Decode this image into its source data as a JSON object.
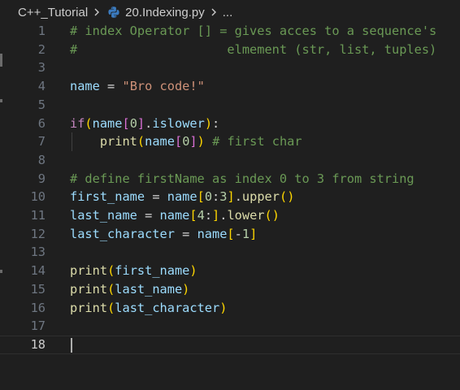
{
  "breadcrumb": {
    "folder": "C++_Tutorial",
    "file": "20.Indexing.py",
    "more": "..."
  },
  "theme": {
    "background": "#1f1f1f",
    "comment": "#6a9955",
    "variable": "#9cdcfe",
    "string": "#ce9178",
    "keyword": "#c586c0",
    "function": "#dcdcaa",
    "number": "#b5cea8",
    "bracket_level1": "#ffd700",
    "bracket_level2": "#da70d6",
    "bracket_level3": "#179fff"
  },
  "editor": {
    "current_line": 18,
    "lines": [
      {
        "num": "1",
        "tokens": [
          {
            "t": "# index Operator [] = gives acces to a sequence's",
            "c": "cm"
          }
        ]
      },
      {
        "num": "2",
        "tokens": [
          {
            "t": "#                    elmement (str, list, tuples)",
            "c": "cm"
          }
        ]
      },
      {
        "num": "3",
        "tokens": []
      },
      {
        "num": "4",
        "tokens": [
          {
            "t": "name",
            "c": "var"
          },
          {
            "t": " = ",
            "c": "op"
          },
          {
            "t": "\"Bro code!\"",
            "c": "str"
          }
        ]
      },
      {
        "num": "5",
        "tokens": []
      },
      {
        "num": "6",
        "tokens": [
          {
            "t": "if",
            "c": "kw"
          },
          {
            "t": "(",
            "c": "b1"
          },
          {
            "t": "name",
            "c": "var"
          },
          {
            "t": "[",
            "c": "b2"
          },
          {
            "t": "0",
            "c": "num"
          },
          {
            "t": "]",
            "c": "b2"
          },
          {
            "t": ".",
            "c": "op"
          },
          {
            "t": "islower",
            "c": "var"
          },
          {
            "t": ")",
            "c": "b1"
          },
          {
            "t": ":",
            "c": "op"
          }
        ]
      },
      {
        "num": "7",
        "tokens": [
          {
            "t": "    ",
            "c": "op"
          },
          {
            "t": "print",
            "c": "fn"
          },
          {
            "t": "(",
            "c": "b1"
          },
          {
            "t": "name",
            "c": "var"
          },
          {
            "t": "[",
            "c": "b2"
          },
          {
            "t": "0",
            "c": "num"
          },
          {
            "t": "]",
            "c": "b2"
          },
          {
            "t": ")",
            "c": "b1"
          },
          {
            "t": " ",
            "c": "op"
          },
          {
            "t": "# first char",
            "c": "cm"
          }
        ]
      },
      {
        "num": "8",
        "tokens": []
      },
      {
        "num": "9",
        "tokens": [
          {
            "t": "# define firstName as index 0 to 3 from string",
            "c": "cm"
          }
        ]
      },
      {
        "num": "10",
        "tokens": [
          {
            "t": "first_name",
            "c": "var"
          },
          {
            "t": " = ",
            "c": "op"
          },
          {
            "t": "name",
            "c": "var"
          },
          {
            "t": "[",
            "c": "b1"
          },
          {
            "t": "0",
            "c": "num"
          },
          {
            "t": ":",
            "c": "op"
          },
          {
            "t": "3",
            "c": "num"
          },
          {
            "t": "]",
            "c": "b1"
          },
          {
            "t": ".",
            "c": "op"
          },
          {
            "t": "upper",
            "c": "fn"
          },
          {
            "t": "(",
            "c": "b1"
          },
          {
            "t": ")",
            "c": "b1"
          }
        ]
      },
      {
        "num": "11",
        "tokens": [
          {
            "t": "last_name",
            "c": "var"
          },
          {
            "t": " = ",
            "c": "op"
          },
          {
            "t": "name",
            "c": "var"
          },
          {
            "t": "[",
            "c": "b1"
          },
          {
            "t": "4",
            "c": "num"
          },
          {
            "t": ":",
            "c": "op"
          },
          {
            "t": "]",
            "c": "b1"
          },
          {
            "t": ".",
            "c": "op"
          },
          {
            "t": "lower",
            "c": "fn"
          },
          {
            "t": "(",
            "c": "b1"
          },
          {
            "t": ")",
            "c": "b1"
          }
        ]
      },
      {
        "num": "12",
        "tokens": [
          {
            "t": "last_character",
            "c": "var"
          },
          {
            "t": " = ",
            "c": "op"
          },
          {
            "t": "name",
            "c": "var"
          },
          {
            "t": "[",
            "c": "b1"
          },
          {
            "t": "-",
            "c": "op"
          },
          {
            "t": "1",
            "c": "num"
          },
          {
            "t": "]",
            "c": "b1"
          }
        ]
      },
      {
        "num": "13",
        "tokens": []
      },
      {
        "num": "14",
        "tokens": [
          {
            "t": "print",
            "c": "fn"
          },
          {
            "t": "(",
            "c": "b1"
          },
          {
            "t": "first_name",
            "c": "var"
          },
          {
            "t": ")",
            "c": "b1"
          }
        ]
      },
      {
        "num": "15",
        "tokens": [
          {
            "t": "print",
            "c": "fn"
          },
          {
            "t": "(",
            "c": "b1"
          },
          {
            "t": "last_name",
            "c": "var"
          },
          {
            "t": ")",
            "c": "b1"
          }
        ]
      },
      {
        "num": "16",
        "tokens": [
          {
            "t": "print",
            "c": "fn"
          },
          {
            "t": "(",
            "c": "b1"
          },
          {
            "t": "last_character",
            "c": "var"
          },
          {
            "t": ")",
            "c": "b1"
          }
        ]
      },
      {
        "num": "17",
        "tokens": []
      },
      {
        "num": "18",
        "tokens": []
      }
    ]
  }
}
